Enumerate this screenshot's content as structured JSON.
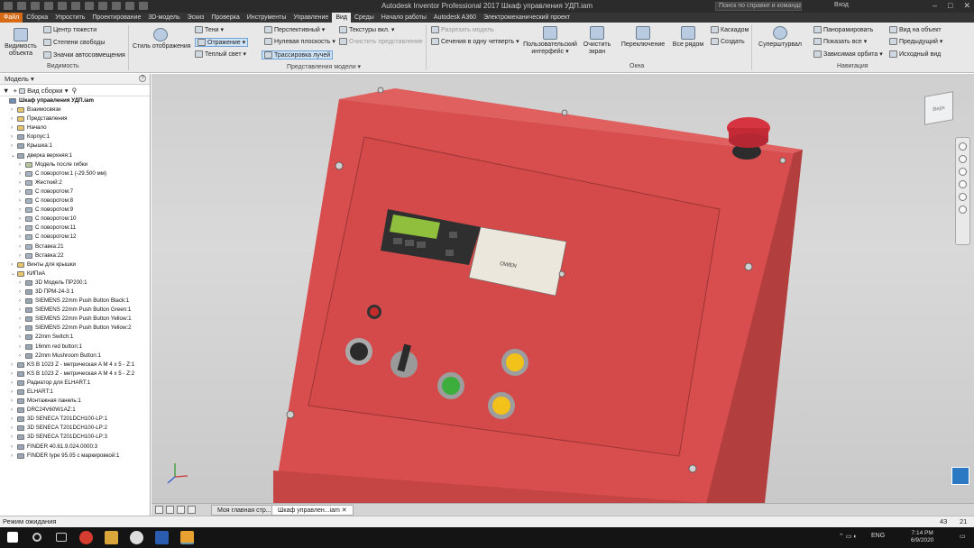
{
  "window": {
    "title": "Autodesk Inventor Professional 2017   Шкаф управления УДП.iam",
    "search_placeholder": "Поиск по справке и командам",
    "user": "Вход"
  },
  "menu": {
    "tabs": [
      "Файл",
      "Сборка",
      "Упростить",
      "Проектирование",
      "3D-модель",
      "Эскиз",
      "Проверка",
      "Инструменты",
      "Управление",
      "Вид",
      "Среды",
      "Начало работы",
      "Autodesk A360",
      "Электромеханический проект"
    ],
    "active_index": 9
  },
  "ribbon": {
    "visibility": {
      "object_visibility": "Видимость объекта",
      "center_of_gravity": "Центр тяжести",
      "dof": "Степени свободы",
      "iMate_glyphs": "Значки автосовмещения",
      "label": "Видимость"
    },
    "appearance": {
      "visual_style": "Стиль отображения",
      "shadows": "Тени",
      "reflections": "Отражение",
      "lighting": "Теплый свет",
      "perspective": "Перспективный",
      "ground_plane": "Нулевая плоскость",
      "ray_tracing": "Трассировка лучей",
      "textures": "Текстуры вкл.",
      "clear_view": "Очистить представление",
      "label": "Представления модели"
    },
    "windows": {
      "split": "Разрезать модель",
      "section_quarter": "Сечения в одну четверть",
      "ui": "Пользовательский интерфейс",
      "clean_screen": "Очистить экран",
      "switch": "Переключение",
      "arrange_all": "Все рядом",
      "cascade": "Каскадом",
      "new": "Создать",
      "label": "Окна"
    },
    "navigate": {
      "steering": "Суперштурвал",
      "pan": "Панорамировать",
      "zoom_all": "Показать все",
      "orbit": "Зависимая орбита",
      "view_face": "Вид на объект",
      "previous": "Предыдущий",
      "home": "Исходный вид",
      "label": "Навигация"
    }
  },
  "browser": {
    "title": "Модель",
    "help": "?",
    "assembly_view": "Вид сборки",
    "tree": [
      {
        "label": "Шкаф управления УДП.iam",
        "level": 0,
        "bold": true,
        "icon": "assembly"
      },
      {
        "label": "Взаимосвязи",
        "level": 1,
        "icon": "folder"
      },
      {
        "label": "Представления",
        "level": 1,
        "icon": "folder"
      },
      {
        "label": "Начало",
        "level": 1,
        "icon": "folder"
      },
      {
        "label": "Корпус:1",
        "level": 1,
        "icon": "part"
      },
      {
        "label": "Крышка:1",
        "level": 1,
        "icon": "part"
      },
      {
        "label": "дверка верхняя:1",
        "level": 1,
        "icon": "part",
        "expanded": true
      },
      {
        "label": "Модель после гибки",
        "level": 2,
        "icon": "sheet"
      },
      {
        "label": "С поворотом:1 (-29.500 мм)",
        "level": 2,
        "icon": "feature"
      },
      {
        "label": "Жесткий:2",
        "level": 2,
        "icon": "feature"
      },
      {
        "label": "С поворотом:7",
        "level": 2,
        "icon": "feature"
      },
      {
        "label": "С поворотом:8",
        "level": 2,
        "icon": "feature"
      },
      {
        "label": "С поворотом:9",
        "level": 2,
        "icon": "feature"
      },
      {
        "label": "С поворотом:10",
        "level": 2,
        "icon": "feature"
      },
      {
        "label": "С поворотом:11",
        "level": 2,
        "icon": "feature"
      },
      {
        "label": "С поворотом:12",
        "level": 2,
        "icon": "feature"
      },
      {
        "label": "Вставка:21",
        "level": 2,
        "icon": "feature"
      },
      {
        "label": "Вставка:22",
        "level": 2,
        "icon": "feature"
      },
      {
        "label": "Винты для крышки",
        "level": 1,
        "icon": "folder"
      },
      {
        "label": "КИПиА",
        "level": 1,
        "icon": "folder",
        "expanded": true
      },
      {
        "label": "3D Модель ПР200:1",
        "level": 2,
        "icon": "part"
      },
      {
        "label": "3D ПРМ-24-3:1",
        "level": 2,
        "icon": "part"
      },
      {
        "label": "SIEMENS 22mm Push Button Black:1",
        "level": 2,
        "icon": "part"
      },
      {
        "label": "SIEMENS 22mm Push Button Green:1",
        "level": 2,
        "icon": "part"
      },
      {
        "label": "SIEMENS 22mm Push Button Yellow:1",
        "level": 2,
        "icon": "part"
      },
      {
        "label": "SIEMENS 22mm Push Button Yellow:2",
        "level": 2,
        "icon": "part"
      },
      {
        "label": "22mm Switch:1",
        "level": 2,
        "icon": "part"
      },
      {
        "label": "16mm red button:1",
        "level": 2,
        "icon": "part"
      },
      {
        "label": "22mm Mushroom Button:1",
        "level": 2,
        "icon": "part"
      },
      {
        "label": "KS B 1023 Z - метрическая A  M 4 x 5 - Z:1",
        "level": 1,
        "icon": "part"
      },
      {
        "label": "KS B 1023 Z - метрическая A  M 4 x 5 - Z:2",
        "level": 1,
        "icon": "part"
      },
      {
        "label": "Радиатор для ELHART:1",
        "level": 1,
        "icon": "part"
      },
      {
        "label": "ELHART:1",
        "level": 1,
        "icon": "part"
      },
      {
        "label": "Монтажная панель:1",
        "level": 1,
        "icon": "part"
      },
      {
        "label": "DRC24V60W1AZ:1",
        "level": 1,
        "icon": "part"
      },
      {
        "label": "3D SENECA T201DCH100-LP:1",
        "level": 1,
        "icon": "part"
      },
      {
        "label": "3D SENECA T201DCH100-LP:2",
        "level": 1,
        "icon": "part"
      },
      {
        "label": "3D SENECA T201DCH100-LP:3",
        "level": 1,
        "icon": "part"
      },
      {
        "label": "FINDER 40.61.9.024.0000:3",
        "level": 1,
        "icon": "part"
      },
      {
        "label": "FINDER type 95.05 с маркировкой:1",
        "level": 1,
        "icon": "part"
      }
    ]
  },
  "viewport": {
    "plc_brand": "OWEN",
    "viewcube_label": "Верх",
    "tabs": [
      "Моя главная стр...",
      "Шкаф управлен...iam"
    ],
    "active_tab": 1
  },
  "status": {
    "text": "Режим ожидания",
    "num1": "43",
    "num2": "21"
  },
  "taskbar": {
    "lang": "ENG",
    "time": "7:14 PM",
    "date": "6/9/2020"
  },
  "colors": {
    "cabinet": "#d84d4d",
    "file_tab": "#d66a17",
    "accent": "#2b79c2"
  }
}
